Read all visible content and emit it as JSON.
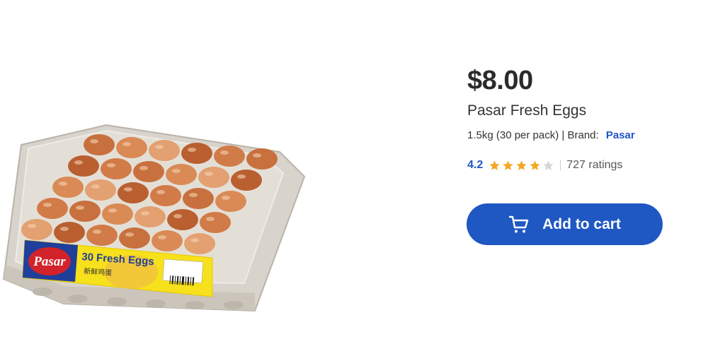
{
  "product": {
    "price": "$8.00",
    "title": "Pasar Fresh Eggs",
    "size": "1.5kg (30 per pack)",
    "brand_prefix": "| Brand:",
    "brand": "Pasar",
    "rating": "4.2",
    "rating_value": 4.2,
    "ratings_count": "727 ratings",
    "image": {
      "logo_text": "Pasar",
      "pack_text": "30 Fresh Eggs",
      "pack_subtext": "新鲜鸡蛋"
    }
  },
  "actions": {
    "add_to_cart_label": "Add to cart",
    "cart_icon": "cart-icon"
  },
  "colors": {
    "accent": "#1f57c3",
    "link": "#1e56c4",
    "star_filled": "#f5a623",
    "star_empty": "#d6d6d6",
    "label_yellow": "#f7e01c",
    "label_red": "#d2232a"
  }
}
